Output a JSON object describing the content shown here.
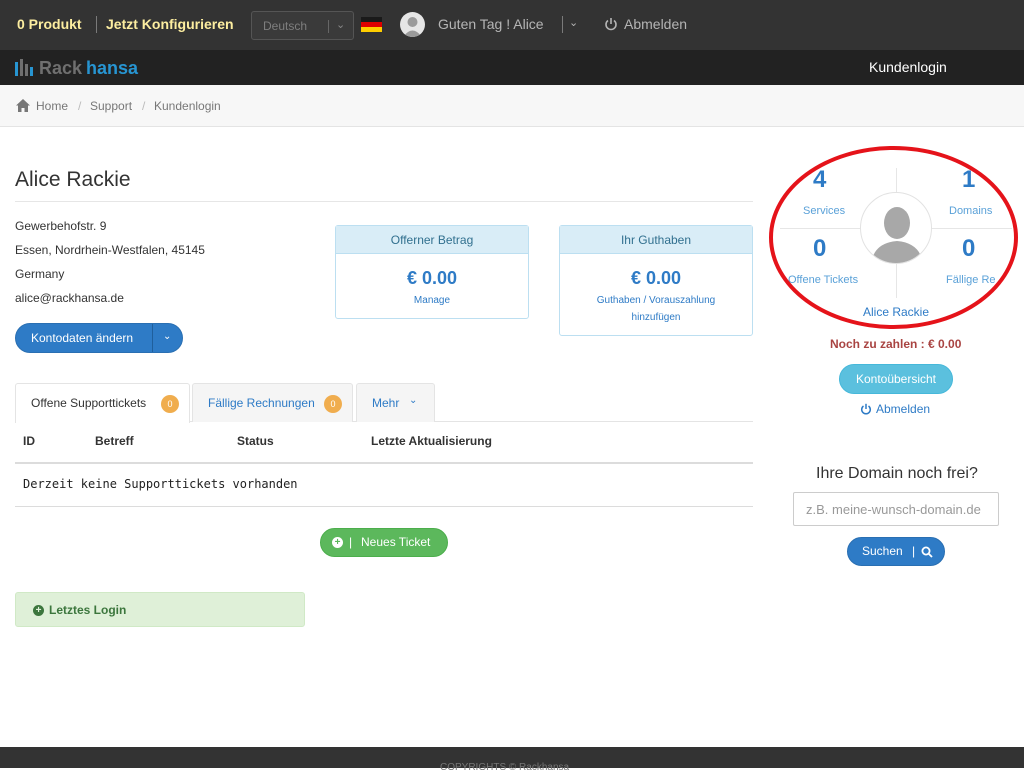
{
  "topbar": {
    "cart": "0 Produkt",
    "configure": "Jetzt Konfigurieren",
    "language": "Deutsch",
    "greeting": "Guten Tag ! Alice",
    "logout": "Abmelden"
  },
  "navbar": {
    "logo_part1": "Rack",
    "logo_part2": "hansa",
    "login": "Kundenlogin"
  },
  "breadcrumb": [
    "Home",
    "Support",
    "Kundenlogin"
  ],
  "account": {
    "name": "Alice Rackie",
    "address": [
      "Gewerbehofstr. 9",
      "Essen, Nordrhein-Westfalen, 45145",
      "Germany",
      "alice@rackhansa.de"
    ],
    "edit_button": "Kontodaten ändern"
  },
  "cards": {
    "open": {
      "title": "Offerner Betrag",
      "amount": "€ 0.00",
      "link": "Manage"
    },
    "credit": {
      "title": "Ihr Guthaben",
      "amount": "€ 0.00",
      "link_line1": "Guthaben / Vorauszahlung",
      "link_line2": "hinzufügen"
    }
  },
  "tabs": [
    {
      "label": "Offene Supporttickets",
      "badge": "0"
    },
    {
      "label": "Fällige Rechnungen",
      "badge": "0"
    },
    {
      "label": "Mehr"
    }
  ],
  "table": {
    "headers": [
      "ID",
      "Betreff",
      "Status",
      "Letzte Aktualisierung"
    ],
    "empty": "Derzeit keine Supporttickets vorhanden"
  },
  "new_ticket": {
    "bar": "|",
    "label": "Neues Ticket"
  },
  "last_login": "Letztes Login",
  "stats": {
    "services": {
      "value": "4",
      "label": "Services"
    },
    "domains": {
      "value": "1",
      "label": "Domains"
    },
    "tickets": {
      "value": "0",
      "label": "Offene Tickets"
    },
    "invoices": {
      "value": "0",
      "label": "Fällige Re"
    }
  },
  "panel": {
    "name": "Alice Rackie",
    "due": "Noch zu zahlen : € 0.00",
    "overview_button": "Kontoübersicht",
    "logout": "Abmelden"
  },
  "domain": {
    "title": "Ihre Domain noch frei?",
    "placeholder": "z.B. meine-wunsch-domain.de",
    "button": "Suchen",
    "bar": "|"
  },
  "footer": "COPYRIGHTS © Rackhansa",
  "colors": {
    "accent": "#2e7bc6",
    "highlight": "#e5131a",
    "topbar": "#333333",
    "navbar": "#222222"
  }
}
